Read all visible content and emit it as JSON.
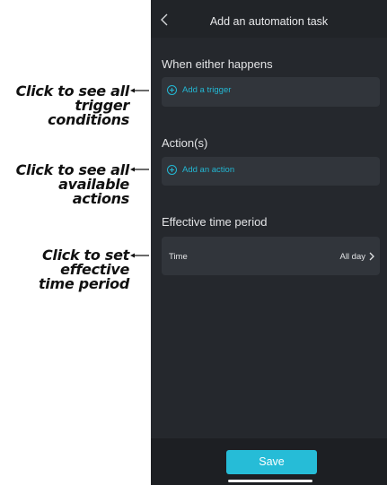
{
  "callouts": [
    {
      "line1": "Click to see all",
      "line2": "trigger conditions"
    },
    {
      "line1": "Click to see all",
      "line2": "available actions"
    },
    {
      "line1": "Click to set effective",
      "line2": "time period"
    }
  ],
  "header": {
    "title": "Add an automation task",
    "back_icon": "chevron-left-icon"
  },
  "sections": {
    "trigger": {
      "title": "When either happens",
      "add_label": "Add a trigger"
    },
    "action": {
      "title": "Action(s)",
      "add_label": "Add an action"
    },
    "period": {
      "title": "Effective time period",
      "row_label": "Time",
      "row_value": "All day"
    }
  },
  "footer": {
    "save_label": "Save"
  },
  "colors": {
    "accent": "#26bcd7",
    "background": "#25282d",
    "card": "#31353b"
  }
}
